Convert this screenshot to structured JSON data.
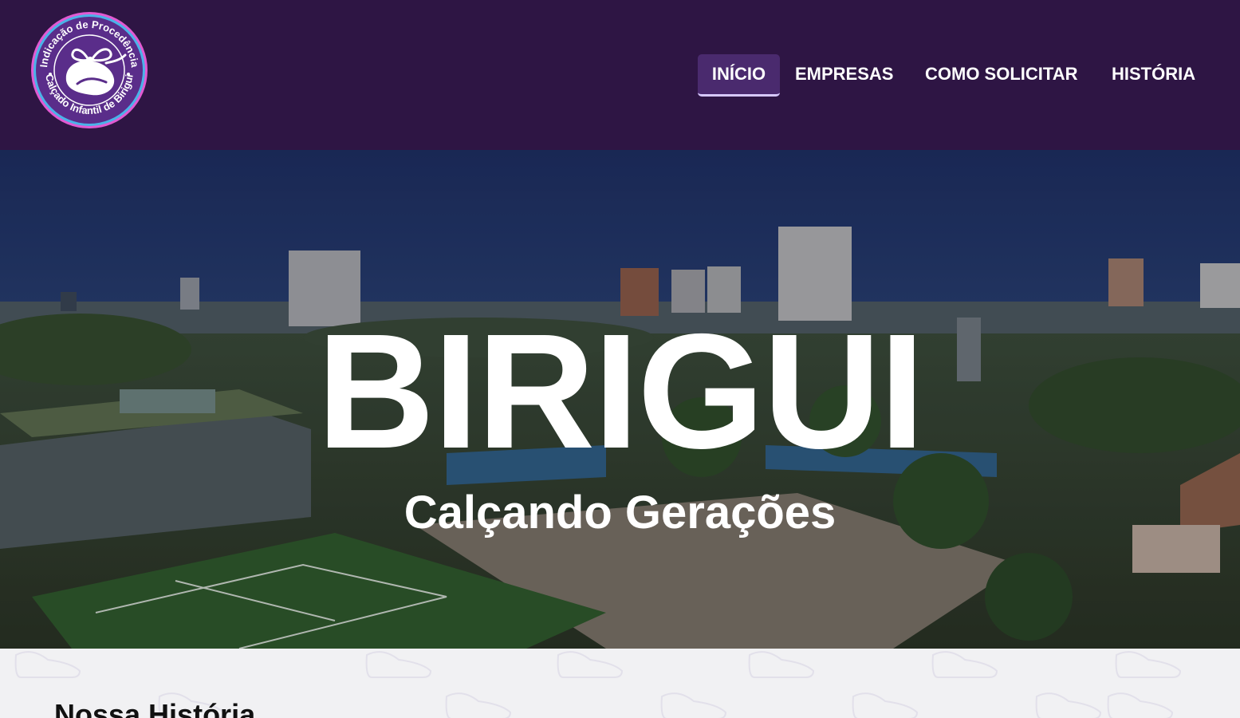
{
  "header": {
    "logo": {
      "ring_top_text": "Indicação de Procedência",
      "ring_bottom_text": "Calçado Infantil de Birigui",
      "icon": "shoe-ribbon-icon"
    },
    "nav": [
      {
        "label": "INÍCIO",
        "active": true
      },
      {
        "label": "EMPRESAS",
        "active": false
      },
      {
        "label": "COMO SOLICITAR",
        "active": false
      },
      {
        "label": "HISTÓRIA",
        "active": false
      }
    ]
  },
  "hero": {
    "title": "BIRIGUI",
    "subtitle": "Calçando Gerações"
  },
  "content": {
    "section_title": "Nossa História",
    "background_icon": "sneaker-outline-icon"
  },
  "colors": {
    "header_bg": "#2e1544",
    "nav_active_bg": "#4a2a6e",
    "logo_bg": "#5a2d8a",
    "logo_ring": "#e15ad2",
    "content_bg": "#f1f1f3"
  }
}
